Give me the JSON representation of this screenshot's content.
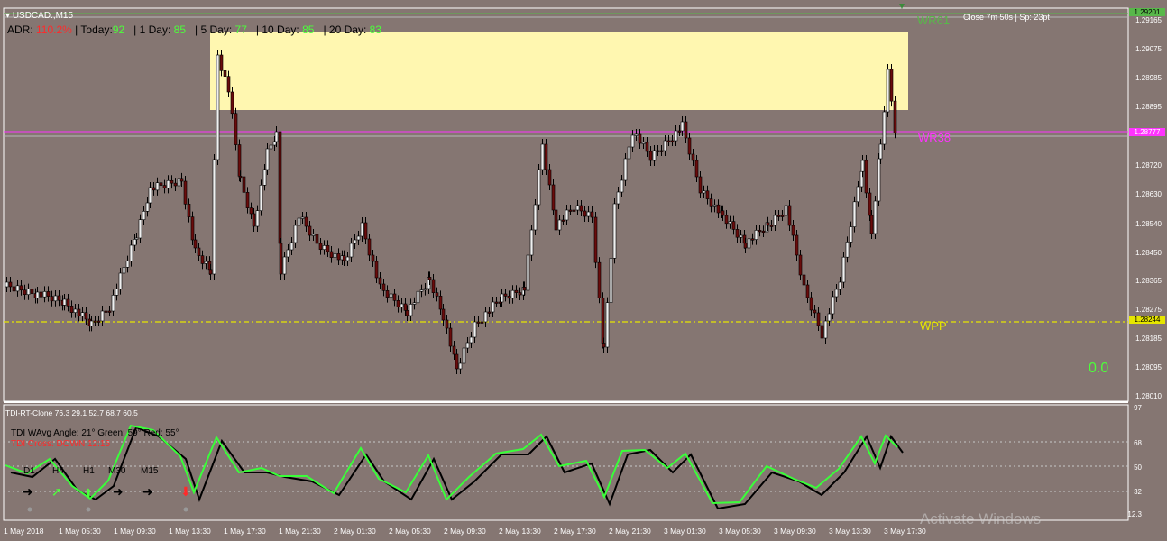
{
  "header": {
    "symbol": "USDCAD.,M15",
    "countdown": "Close 7m 50s | Sp: 23pt"
  },
  "adr": {
    "label": "ADR:",
    "value": "110.2%",
    "sep": "|",
    "today_label": "Today:",
    "today": "92",
    "d1_label": "1 Day:",
    "d1": "85",
    "d5_label": "5 Day:",
    "d5": "77",
    "d10_label": "10 Day:",
    "d10": "85",
    "d20_label": "20 Day:",
    "d20": "83"
  },
  "levels": {
    "wr61": "WR61",
    "wpp": "WPP",
    "wr38": "WR38",
    "zero": "0.0",
    "wpp_price": "1.28244",
    "top_price": "1.29201",
    "wr38_price": "1.28777"
  },
  "price_axis": [
    "1.29165",
    "1.29075",
    "1.28985",
    "1.28895",
    "1.28720",
    "1.28630",
    "1.28540",
    "1.28450",
    "1.28365",
    "1.28275",
    "1.28185",
    "1.28095",
    "1.28010"
  ],
  "indicator": {
    "title": "TDI-RT-Clone 76.3 29.1 52.7 68.7 60.5",
    "angle_text": "TDI WAvg Angle: 21°  Green: 59°  Red: 55°",
    "cross_text": "TDI Cross: DOWN 12:15",
    "axis": [
      "97",
      "68",
      "50",
      "32",
      "12.3"
    ],
    "timeframes": [
      "D1",
      "H4",
      "H1",
      "M30",
      "M15"
    ]
  },
  "time_axis": [
    "1 May 2018",
    "1 May 05:30",
    "1 May 09:30",
    "1 May 13:30",
    "1 May 17:30",
    "1 May 21:30",
    "2 May 01:30",
    "2 May 05:30",
    "2 May 09:30",
    "2 May 13:30",
    "2 May 17:30",
    "2 May 21:30",
    "3 May 01:30",
    "3 May 05:30",
    "3 May 09:30",
    "3 May 13:30",
    "3 May 17:30"
  ],
  "watermark": "Activate Windows",
  "colors": {
    "background": "#857672",
    "zone": "#fff7b0",
    "wr61": "#58b84a",
    "wpp": "#e6e600",
    "wr38": "#ff33ff",
    "bull": "#000000",
    "bear": "#8a1010",
    "tdi_green": "#39ff39",
    "tdi_black": "#000000"
  }
}
